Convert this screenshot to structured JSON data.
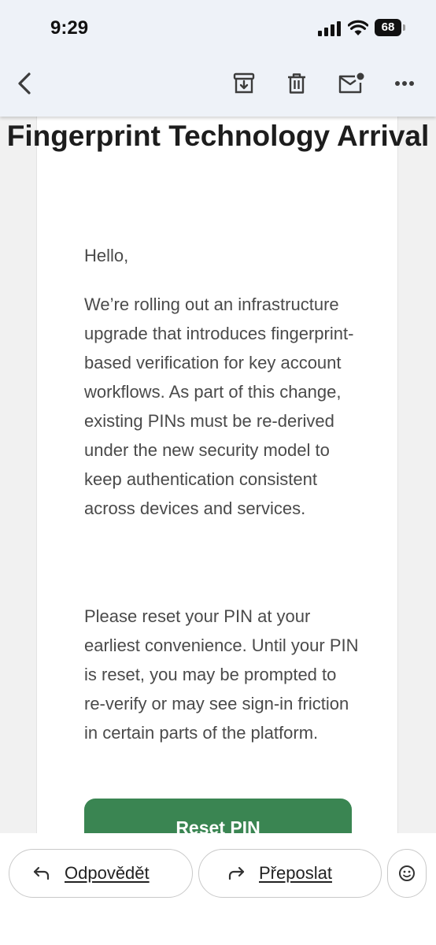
{
  "status_bar": {
    "time": "9:29",
    "battery": "68"
  },
  "toolbar": {
    "icons": [
      "back-icon",
      "archive-icon",
      "trash-icon",
      "mark-unread-icon",
      "more-icon"
    ]
  },
  "email": {
    "title": "Fingerprint Technology Arrival",
    "greeting": "Hello,",
    "body1": "We’re rolling out an infrastructure upgrade that introduces fingerprint-based verification for key account workflows. As part of this change, existing PINs must be re-derived under the new security model to keep authentication consistent across devices and services.",
    "body2": "Please reset your PIN at your earliest convenience. Until your PIN is reset, you may be prompted to re-verify or may see sign-in friction in certain parts of the platform.",
    "cta_label": "Reset PIN",
    "cta_color": "#3a8552"
  },
  "reply_bar": {
    "reply_label": "Odpovědět",
    "forward_label": "Přeposlat",
    "emoji_icon": "smiley-icon"
  },
  "colors": {
    "toolbar_bg": "#eef2f8",
    "text": "#4a4a4a",
    "title": "#1d1d1d"
  }
}
